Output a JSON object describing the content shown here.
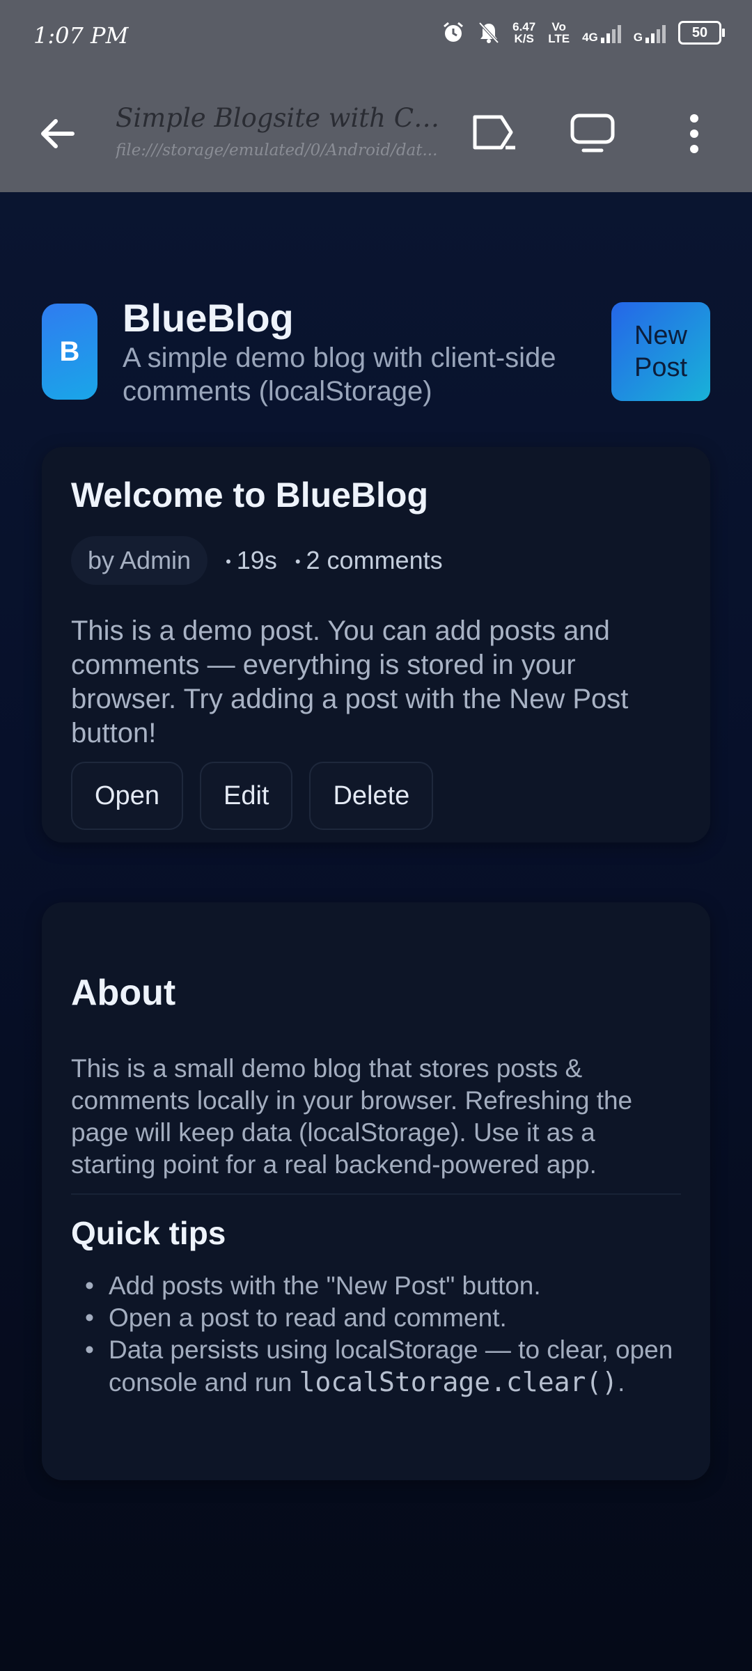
{
  "status_bar": {
    "time": "1:07 PM",
    "net_speed_value": "6.47",
    "net_speed_unit": "K/S",
    "volte_top": "Vo",
    "volte_bottom": "LTE",
    "network_type": "4G",
    "second_sim": "G",
    "battery": "50",
    "icons": [
      "alarm-icon",
      "mute-icon",
      "signal-icon"
    ]
  },
  "browser": {
    "page_title": "Simple Blogsite with Comme...",
    "url": "file:///storage/emulated/0/Android/dat...",
    "icons": [
      "back-arrow-icon",
      "cast-icon",
      "desktop-site-icon",
      "more-menu-icon"
    ]
  },
  "header": {
    "logo_letter": "B",
    "title": "BlueBlog",
    "subtitle": "A simple demo blog with client-side comments (localStorage)",
    "new_post_label": "New Post"
  },
  "post": {
    "title": "Welcome to BlueBlog",
    "author": "by Admin",
    "age": "19s",
    "comments": "2 comments",
    "body": "This is a demo post. You can add posts and comments — everything is stored in your browser. Try adding a post with the New Post button!",
    "actions": {
      "open": "Open",
      "edit": "Edit",
      "delete": "Delete"
    }
  },
  "about": {
    "title": "About",
    "text": "This is a small demo blog that stores posts & comments locally in your browser. Refreshing the page will keep data (localStorage). Use it as a starting point for a real backend-powered app.",
    "tips_title": "Quick tips",
    "tips": [
      "Add posts with the \"New Post\" button.",
      "Open a post to read and comment.",
      "Data persists using localStorage — to clear, open console and run"
    ],
    "tip_code": "localStorage.clear()",
    "tip_end": "."
  },
  "colors": {
    "accent_gradient_start": "#2566e8",
    "accent_gradient_end": "#19b2d8",
    "page_background": "#060c1c",
    "card_background": "#0d1527",
    "chrome_background": "#5a5d66"
  }
}
